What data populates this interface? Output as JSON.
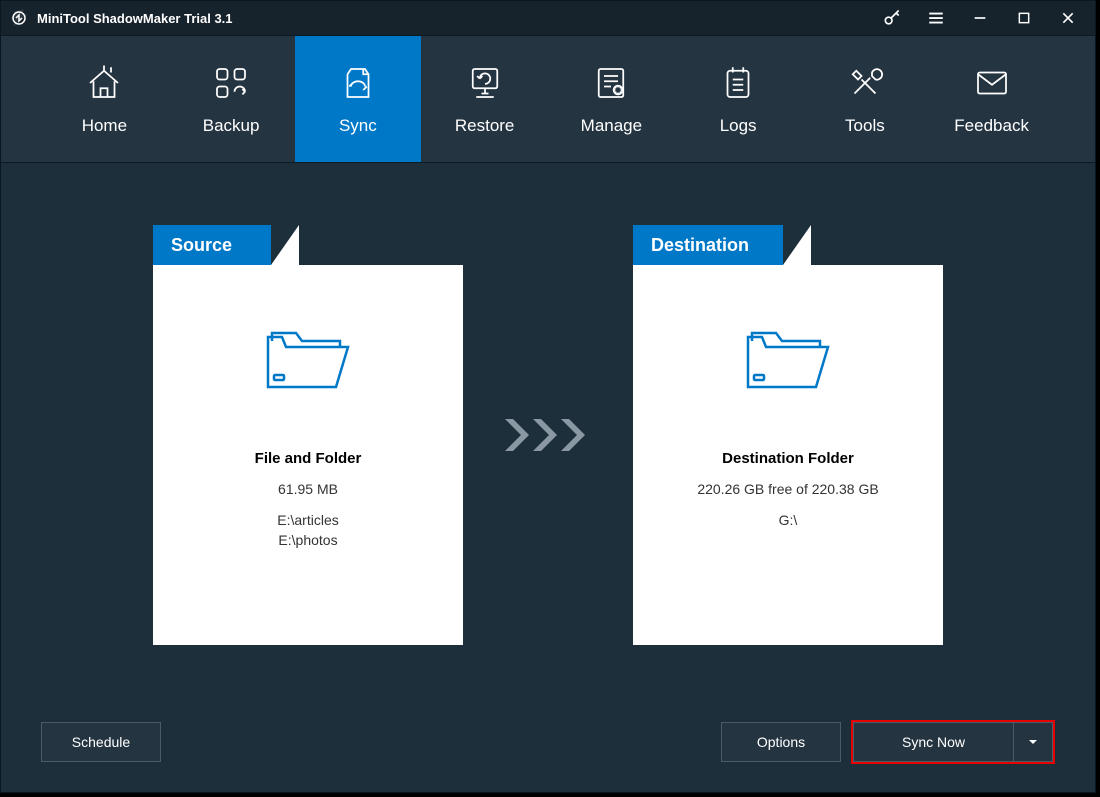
{
  "app": {
    "title": "MiniTool ShadowMaker Trial 3.1"
  },
  "toolbar": {
    "items": [
      {
        "label": "Home"
      },
      {
        "label": "Backup"
      },
      {
        "label": "Sync"
      },
      {
        "label": "Restore"
      },
      {
        "label": "Manage"
      },
      {
        "label": "Logs"
      },
      {
        "label": "Tools"
      },
      {
        "label": "Feedback"
      }
    ]
  },
  "source": {
    "heading": "Source",
    "title": "File and Folder",
    "size": "61.95 MB",
    "path1": "E:\\articles",
    "path2": "E:\\photos"
  },
  "destination": {
    "heading": "Destination",
    "title": "Destination Folder",
    "size": "220.26 GB free of 220.38 GB",
    "path1": "G:\\"
  },
  "footer": {
    "schedule": "Schedule",
    "options": "Options",
    "syncNow": "Sync Now"
  },
  "colors": {
    "accent": "#0078c8",
    "panelBg": "#1e2f3c",
    "toolbarBg": "#253441",
    "highlight": "#e60000"
  }
}
